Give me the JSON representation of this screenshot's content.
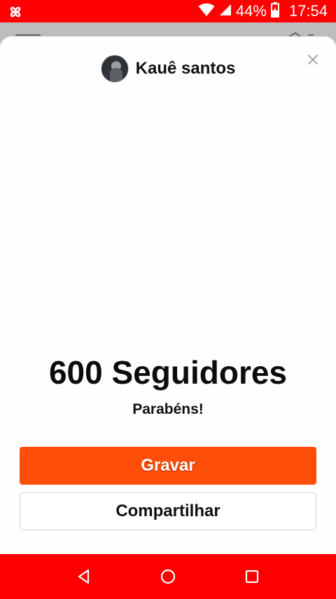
{
  "status_bar": {
    "battery": "44%",
    "time": "17:54",
    "app_icon": "pinwheel-icon",
    "wifi_icon": "wifi-icon",
    "signal_icon": "signal-icon",
    "battery_icon": "battery-charging-icon",
    "background_color": "#ff0000"
  },
  "dialog": {
    "user_name": "Kauê santos",
    "close_icon": "close-icon",
    "milestone_title": "600 Seguidores",
    "message": "Parabéns!",
    "primary_button_label": "Gravar",
    "secondary_button_label": "Compartilhar",
    "primary_color": "#ff4d0a"
  },
  "nav_bar": {
    "back_icon": "back-triangle-icon",
    "home_icon": "home-circle-icon",
    "recent_icon": "recent-square-icon",
    "background_color": "#ff0000"
  }
}
